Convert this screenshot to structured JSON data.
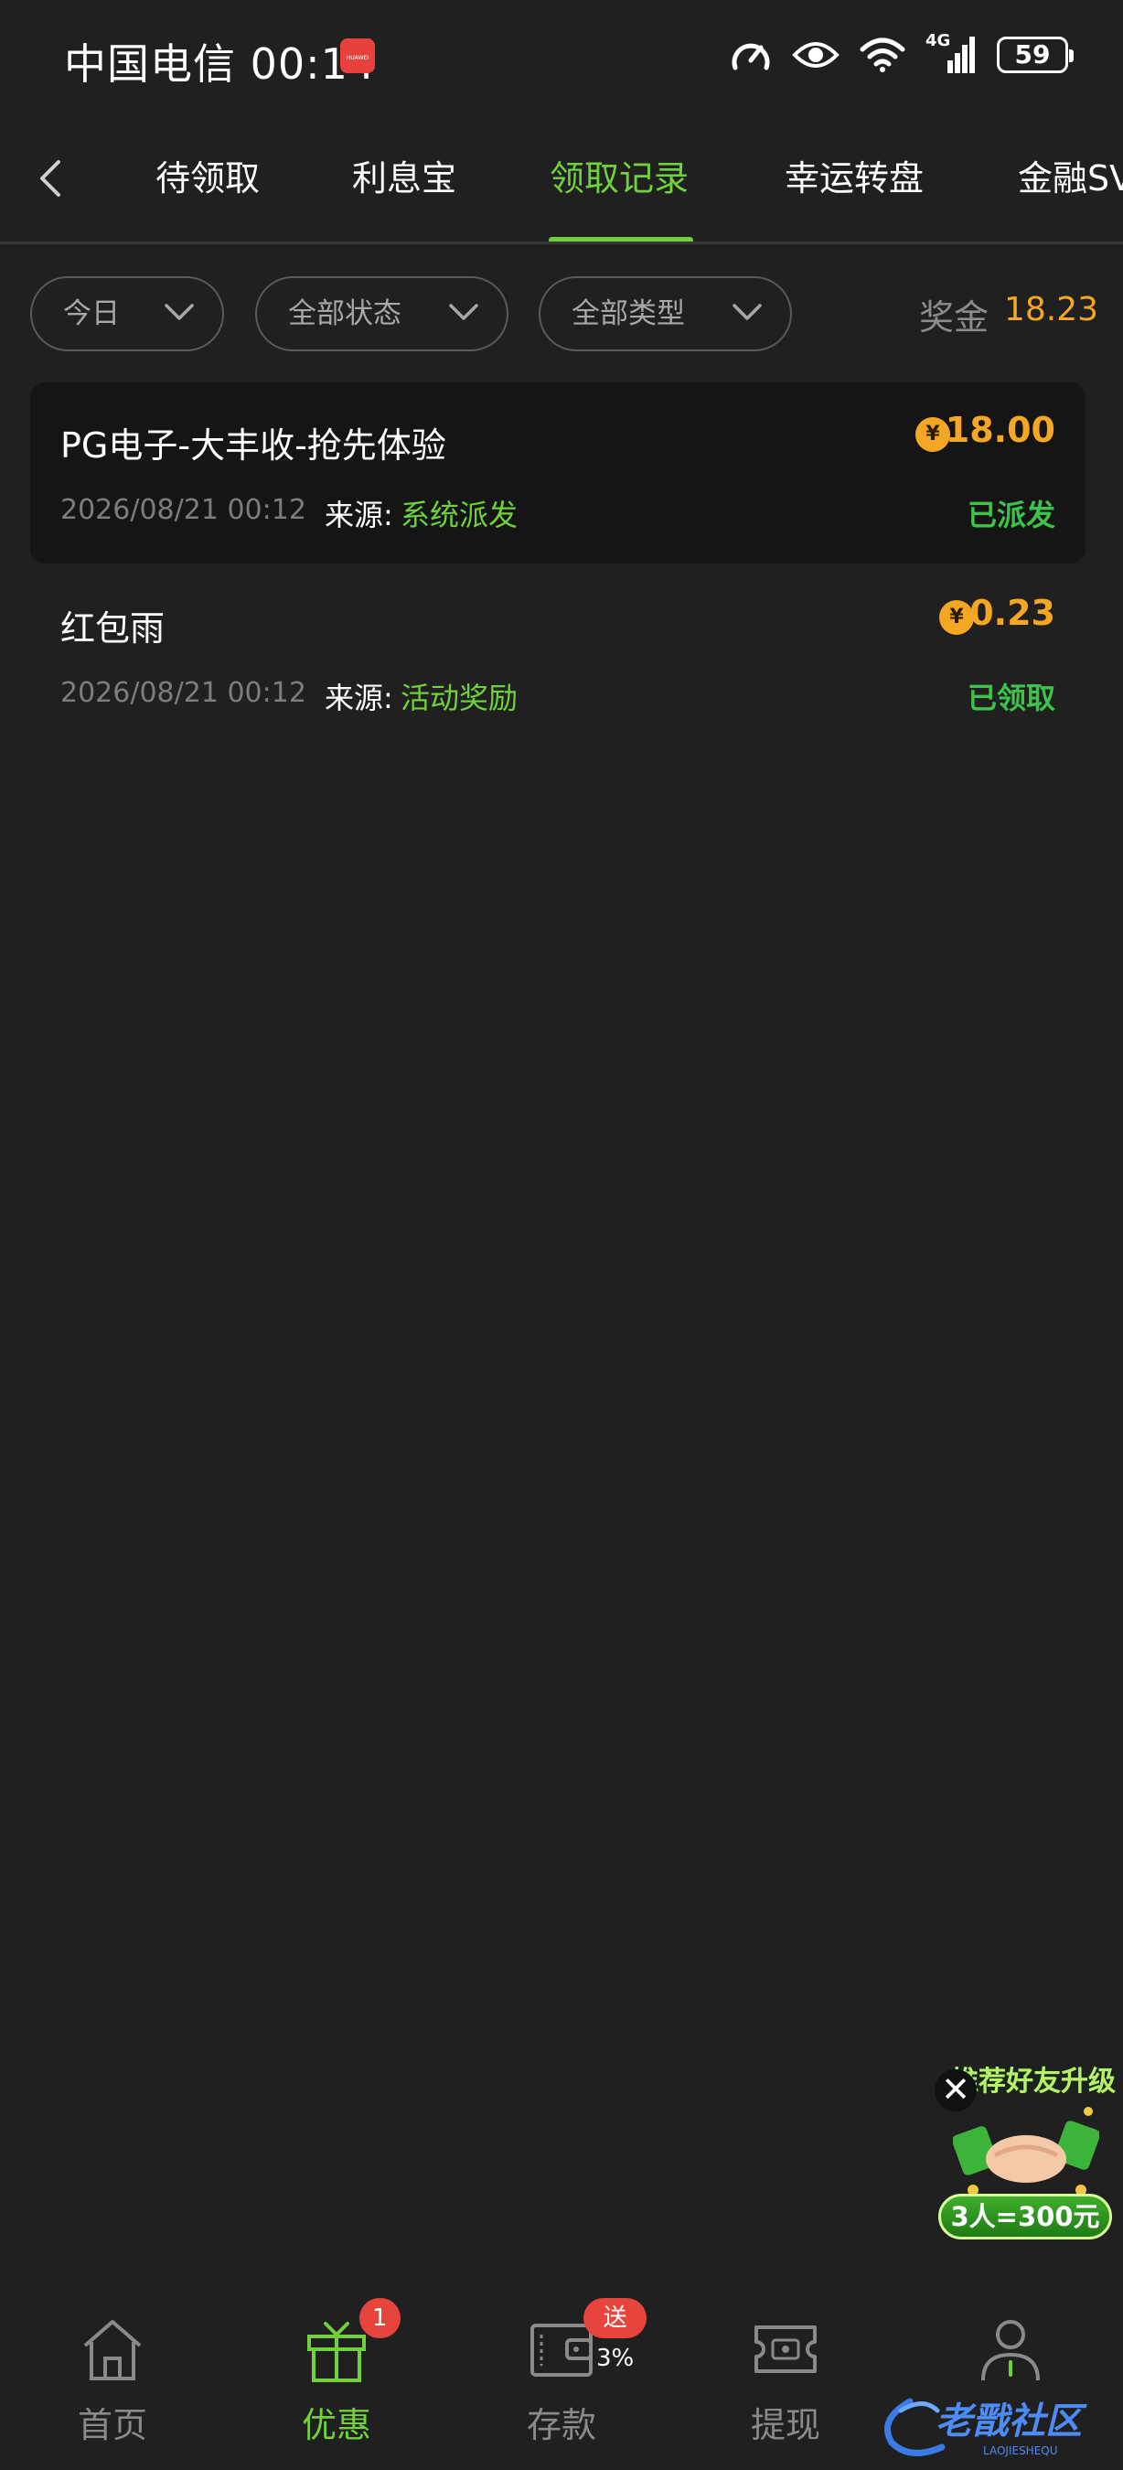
{
  "status_bar": {
    "carrier_time": "中国电信 00:14",
    "signal_label": "4G",
    "battery": "59"
  },
  "top_nav": {
    "tabs": [
      {
        "label": "待领取"
      },
      {
        "label": "利息宝"
      },
      {
        "label": "领取记录"
      },
      {
        "label": "幸运转盘"
      },
      {
        "label": "金融SV"
      }
    ],
    "active_tab": "领取记录"
  },
  "filters": {
    "date": "今日",
    "status": "全部状态",
    "type": "全部类型"
  },
  "bonus": {
    "label": "奖金",
    "value": "18.23"
  },
  "records": [
    {
      "title": "PG电子-大丰收-抢先体验",
      "time": "2026/08/21 00:12",
      "source_label": "来源:",
      "source": "系统派发",
      "currency": "¥",
      "amount": "18.00",
      "status": "已派发"
    },
    {
      "title": "红包雨",
      "time": "2026/08/21 00:12",
      "source_label": "来源:",
      "source": "活动奖励",
      "currency": "¥",
      "amount": "0.23",
      "status": "已领取"
    }
  ],
  "promo": {
    "close": "✕",
    "top_text": "推荐好友升级",
    "bottom_text": "3人=300元"
  },
  "bottom_nav": {
    "items": [
      {
        "label": "首页"
      },
      {
        "label": "优惠",
        "badge": "1"
      },
      {
        "label": "存款",
        "badge": "送3%"
      },
      {
        "label": "提现"
      },
      {
        "label": "我的"
      }
    ],
    "active": "优惠"
  },
  "watermark": {
    "text": "老戬社区",
    "subtext": "LAOJIESHEQU"
  },
  "colors": {
    "background": "#202020",
    "accent_green": "#6fd23b",
    "amount_orange": "#f5a623",
    "status_green": "#3dc24a",
    "badge_red": "#e6443c"
  }
}
